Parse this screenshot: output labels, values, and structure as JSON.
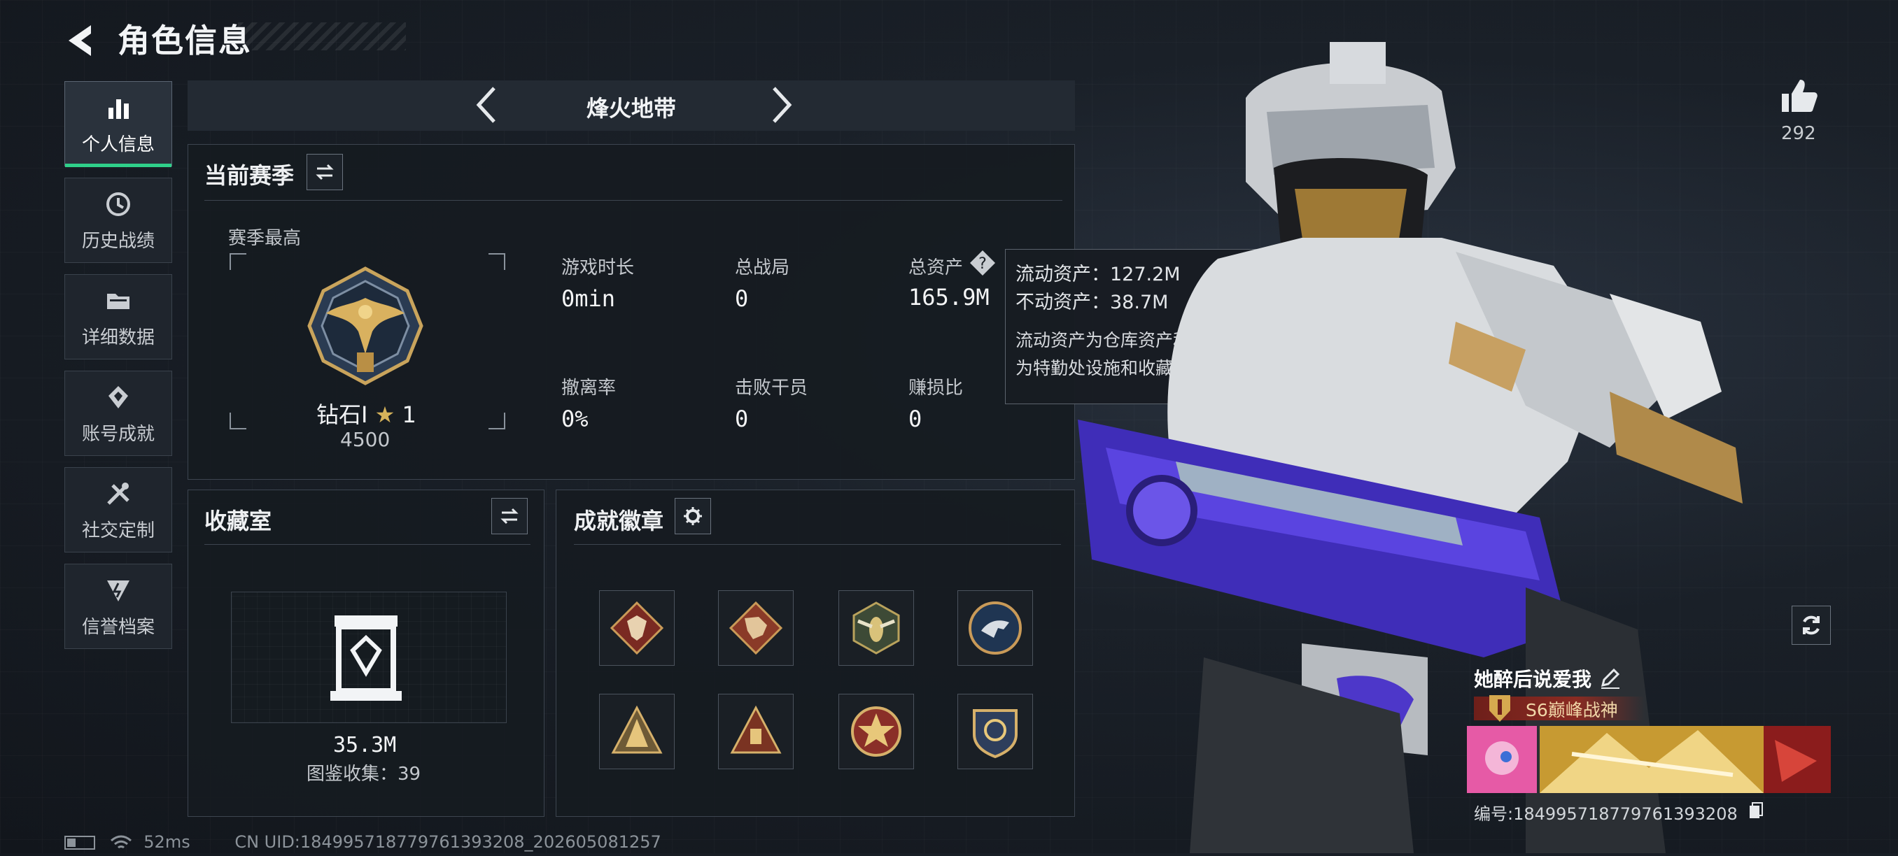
{
  "header": {
    "title": "角色信息"
  },
  "nav": {
    "items": [
      {
        "label": "个人信息",
        "icon": "bar-chart-icon",
        "active": true
      },
      {
        "label": "历史战绩",
        "icon": "history-icon"
      },
      {
        "label": "详细数据",
        "icon": "folder-icon"
      },
      {
        "label": "账号成就",
        "icon": "achievement-icon"
      },
      {
        "label": "社交定制",
        "icon": "tools-icon"
      },
      {
        "label": "信誉档案",
        "icon": "shield-icon"
      }
    ]
  },
  "mode": {
    "title": "烽火地带"
  },
  "season": {
    "title": "当前赛季",
    "best_label": "赛季最高",
    "rank_name": "钻石Ⅰ",
    "rank_star": "★",
    "rank_level": "1",
    "rank_score": "4500",
    "stats": [
      {
        "label": "游戏时长",
        "value": "0min"
      },
      {
        "label": "总战局",
        "value": "0"
      },
      {
        "label": "总资产",
        "value": "165.9M"
      },
      {
        "label": "撤离率",
        "value": "0%"
      },
      {
        "label": "击败干员",
        "value": "0"
      },
      {
        "label": "赚损比",
        "value": "0"
      }
    ]
  },
  "tooltip": {
    "liquid": "流动资产：127.2M",
    "fixed": "不动资产：38.7M",
    "desc_line1": "流动资产为仓库资产和哈夫币，不动资产",
    "desc_line2": "为特勤处设施和收藏室设施"
  },
  "collection": {
    "title": "收藏室",
    "value": "35.3M",
    "catalog": "图鉴收集：39"
  },
  "achievements": {
    "title": "成就徽章",
    "badges": [
      "wolf-badge-icon",
      "dragon-badge-icon",
      "hornet-badge-icon",
      "eagle-badge-icon",
      "pyramid-badge-icon",
      "triangle-badge-icon",
      "star-badge-icon",
      "crest-badge-icon"
    ]
  },
  "player": {
    "likes": "292",
    "name": "她醉后说爱我",
    "rank_title": "S6巅峰战神",
    "id": "编号:184995718779761393208"
  },
  "status": {
    "ping": "52ms",
    "uid": "CN UID:184995718779761393208_202605081257"
  },
  "colors": {
    "accent": "#2fd08a",
    "gold": "#d6a94f",
    "purple": "#5b2dd6"
  }
}
